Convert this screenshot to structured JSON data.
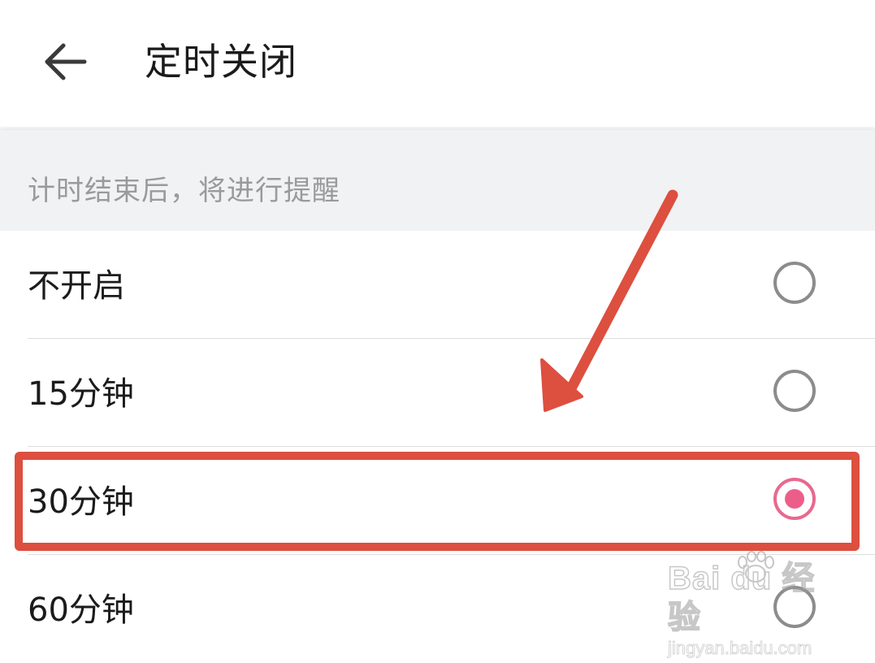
{
  "header": {
    "back_icon": "arrow-left-icon",
    "title": "定时关闭"
  },
  "section": {
    "note": "计时结束后，将进行提醒"
  },
  "options": [
    {
      "label": "不开启",
      "selected": false
    },
    {
      "label": "15分钟",
      "selected": false
    },
    {
      "label": "30分钟",
      "selected": true
    },
    {
      "label": "60分钟",
      "selected": false
    }
  ],
  "colors": {
    "accent": "#ec5e8a",
    "annotation": "#dd4f3f",
    "section_bg": "#f1f2f4"
  },
  "watermark": {
    "brand": "Bai du 经验",
    "url": "jingyan.baidu.com"
  }
}
